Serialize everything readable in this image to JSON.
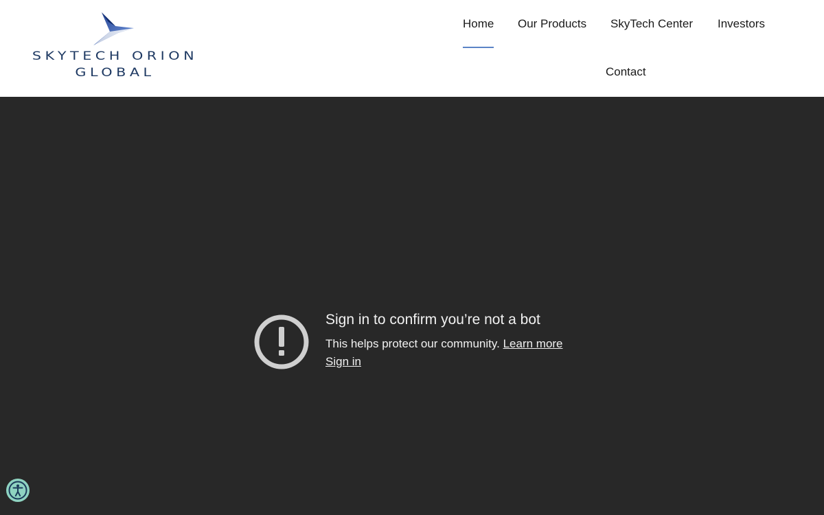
{
  "brand": {
    "line1": "SKYTECH ORION",
    "line2": "GLOBAL",
    "primary_color": "#1f3a63",
    "accent_color": "#3a5fb0"
  },
  "nav": {
    "items": [
      {
        "label": "Home",
        "active": true
      },
      {
        "label": "Our Products"
      },
      {
        "label": "SkyTech Center"
      },
      {
        "label": "Investors"
      },
      {
        "label": "Contact"
      }
    ],
    "active_color": "#5b84c6"
  },
  "video_notice": {
    "icon": "exclamation-circle-icon",
    "title": "Sign in to confirm you’re not a bot",
    "body": "This helps protect our community.",
    "learn_more": "Learn more",
    "sign_in": "Sign in",
    "background": "#282828"
  },
  "accessibility": {
    "icon": "accessibility-icon",
    "color": "#8fd3c1"
  }
}
